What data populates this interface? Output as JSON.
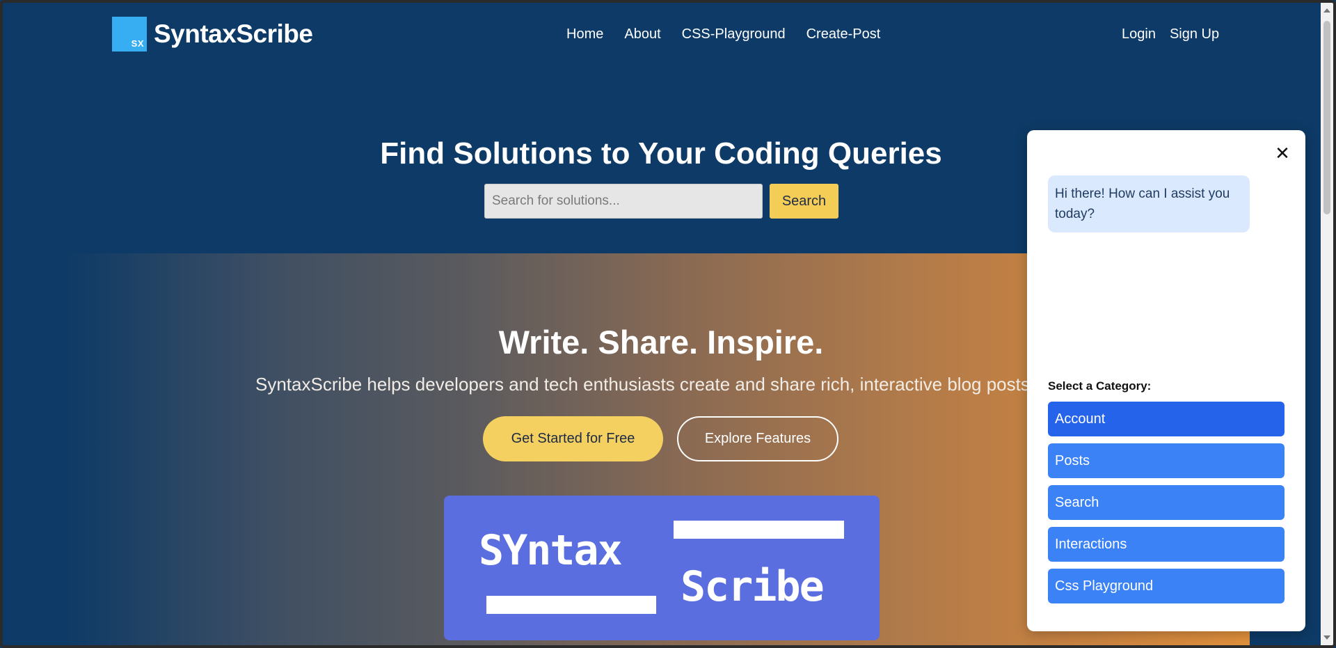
{
  "brand": {
    "logo_text": "SX",
    "name": "SyntaxScribe"
  },
  "nav": {
    "center": [
      "Home",
      "About",
      "CSS-Playground",
      "Create-Post"
    ],
    "right": [
      "Login",
      "Sign Up"
    ]
  },
  "hero": {
    "title": "Find Solutions to Your Coding Queries",
    "search_placeholder": "Search for solutions...",
    "search_button": "Search"
  },
  "section": {
    "title": "Write. Share. Inspire.",
    "subtitle": "SyntaxScribe helps developers and tech enthusiasts create and share rich, interactive blog posts with",
    "cta_primary": "Get Started for Free",
    "cta_secondary": "Explore Features",
    "banner_words": [
      "SYntax",
      "Scribe"
    ],
    "banner_color": "#5b6ee0"
  },
  "chat": {
    "close_icon": "close-icon",
    "greeting": "Hi there! How can I assist you today?",
    "category_label": "Select a Category:",
    "categories": [
      "Account",
      "Posts",
      "Search",
      "Interactions",
      "Css Playground"
    ],
    "active_category": "Account"
  },
  "colors": {
    "navy": "#0d3a66",
    "accent_yellow": "#f4cd57",
    "chat_blue": "#3b82f6",
    "chat_blue_active": "#2563eb"
  }
}
